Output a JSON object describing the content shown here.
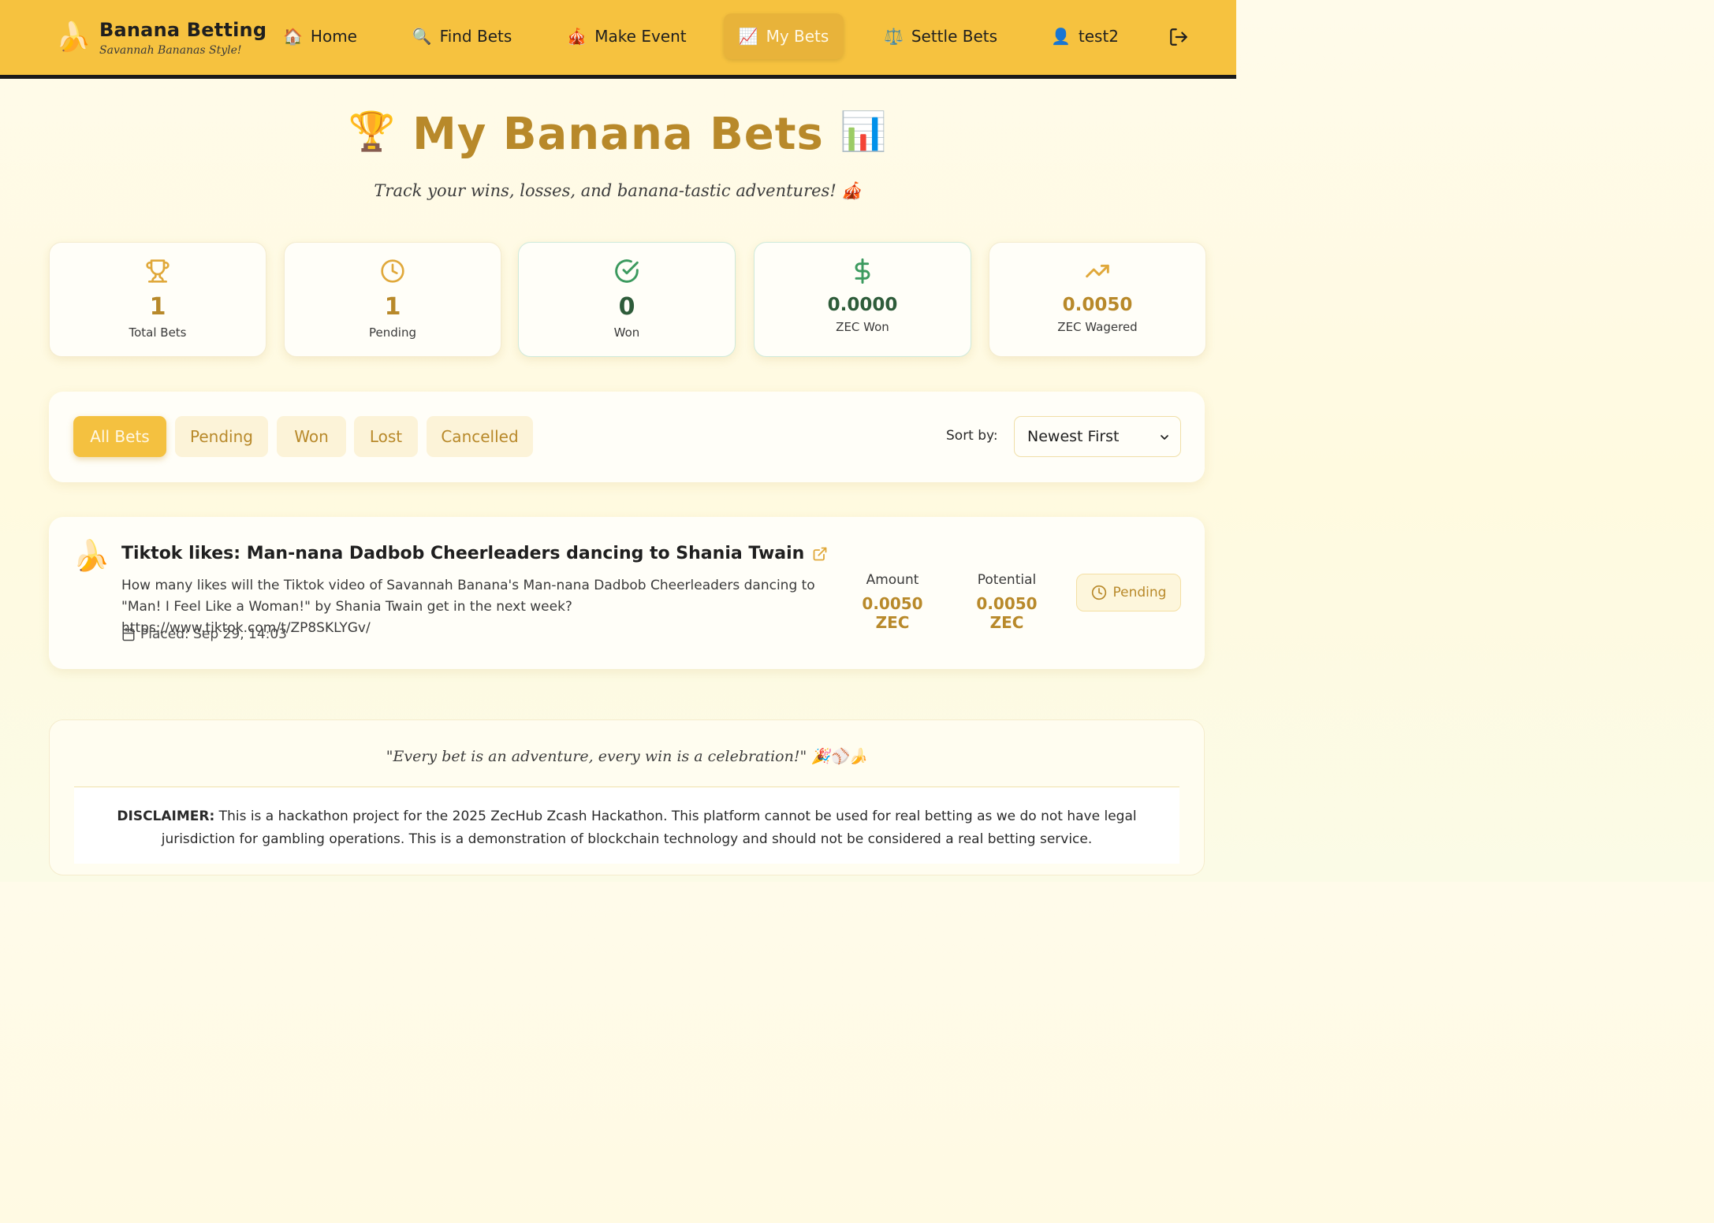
{
  "brand": {
    "icon": "banana",
    "emoji": "🍌",
    "title": "Banana Betting",
    "subtitle": "Savannah Bananas Style!"
  },
  "nav": {
    "items": [
      {
        "label": "Home",
        "emoji": "🏠",
        "icon": "house-icon"
      },
      {
        "label": "Find Bets",
        "emoji": "🔍",
        "icon": "magnifier-icon"
      },
      {
        "label": "Make Event",
        "emoji": "🎪",
        "icon": "circus-tent-icon"
      },
      {
        "label": "My Bets",
        "emoji": "📈",
        "icon": "chart-up-icon",
        "active": true
      },
      {
        "label": "Settle Bets",
        "emoji": "⚖️",
        "icon": "scales-icon"
      },
      {
        "label": "test2",
        "emoji": "👤",
        "icon": "user-icon"
      }
    ],
    "logout_icon": "logout-icon"
  },
  "header": {
    "title": "My Banana Bets",
    "title_left_emoji": "🏆",
    "title_right_emoji": "📊",
    "subtitle": "Track your wins, losses, and banana-tastic adventures! 🎪"
  },
  "stats": [
    {
      "value": "1",
      "label": "Total Bets",
      "icon": "trophy-icon"
    },
    {
      "value": "1",
      "label": "Pending",
      "icon": "clock-icon"
    },
    {
      "value": "0",
      "label": "Won",
      "icon": "check-circle-icon"
    },
    {
      "value": "0.0000",
      "label": "ZEC Won",
      "icon": "dollar-icon"
    },
    {
      "value": "0.0050",
      "label": "ZEC Wagered",
      "icon": "trending-up-icon"
    }
  ],
  "filters": {
    "buttons": [
      "All Bets",
      "Pending",
      "Won",
      "Lost",
      "Cancelled"
    ],
    "active": "All Bets",
    "sort_label": "Sort by:",
    "sort_value": "Newest First"
  },
  "bet": {
    "emoji": "🍌",
    "title": "Tiktok likes: Man-nana Dadbob Cheerleaders dancing to Shania Twain",
    "description": "How many likes will the Tiktok video of Savannah Banana's Man-nana Dadbob Cheerleaders dancing to \"Man! I Feel Like a Woman!\" by Shania Twain get in the next week? https://www.tiktok.com/t/ZP8SKLYGv/",
    "placed": "Placed: Sep 29, 14:03",
    "amount_label": "Amount",
    "amount_value": "0.0050 ZEC",
    "potential_label": "Potential",
    "potential_value": "0.0050 ZEC",
    "status": "Pending"
  },
  "footer": {
    "quote": "\"Every bet is an adventure, every win is a celebration!\" 🎉⚾🍌",
    "disclaimer_label": "DISCLAIMER:",
    "disclaimer_text": " This is a hackathon project for the 2025 ZecHub Zcash Hackathon. This platform cannot be used for real betting as we do not have legal jurisdiction for gambling operations. This is a demonstration of blockchain technology and should not be considered a real betting service."
  },
  "colors": {
    "nav_bg": "#f6c23f",
    "accent_gold": "#b8892a",
    "active_btn": "#f4c140",
    "success_green": "#3c9a5f",
    "dark_green": "#2e5c3a"
  }
}
